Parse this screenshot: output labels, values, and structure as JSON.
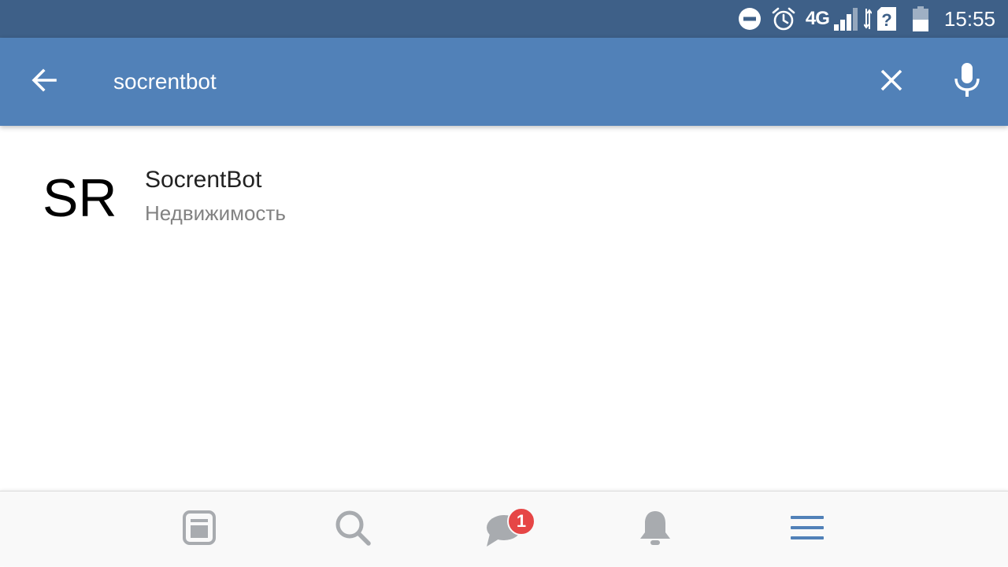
{
  "status_bar": {
    "network": "4G",
    "time": "15:55"
  },
  "toolbar": {
    "search_value": "socrentbot",
    "back_icon": "arrow-left-icon",
    "clear_icon": "close-icon",
    "mic_icon": "microphone-icon"
  },
  "results": [
    {
      "avatar_text": "SR",
      "title": "SocrentBot",
      "subtitle": "Недвижимость"
    }
  ],
  "bottom_nav": {
    "items": [
      {
        "icon": "news-icon"
      },
      {
        "icon": "search-icon"
      },
      {
        "icon": "messages-icon",
        "badge": "1"
      },
      {
        "icon": "notifications-icon"
      },
      {
        "icon": "menu-icon"
      }
    ]
  },
  "colors": {
    "status_bar": "#3e6088",
    "toolbar": "#5181b8",
    "nav_inactive": "#a8abaf",
    "nav_active": "#5181b8",
    "badge": "#e64646"
  }
}
